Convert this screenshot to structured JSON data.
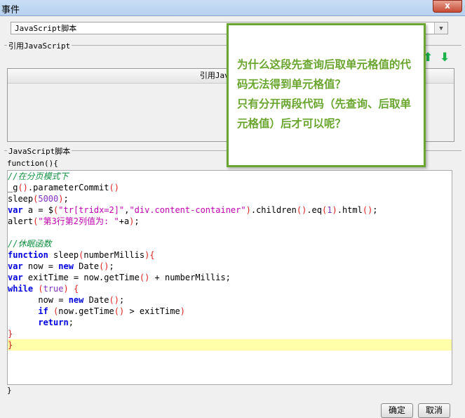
{
  "window": {
    "title": "事件",
    "close": "x"
  },
  "select": {
    "value": "JavaScript脚本"
  },
  "ref_section": {
    "legend": "引用JavaScript",
    "column_header": "引用JavaScript",
    "up": "⬆",
    "down": "⬇"
  },
  "script_section": {
    "legend": "JavaScript脚本",
    "head": "function(){",
    "tail": "}"
  },
  "code": [
    [
      [
        "cm",
        "//在分页模式下"
      ]
    ],
    [
      [
        "",
        "_g"
      ],
      [
        "p",
        "()"
      ],
      [
        "",
        ".parameterCommit"
      ],
      [
        "p",
        "()"
      ]
    ],
    [
      [
        "",
        "sleep"
      ],
      [
        "p",
        "("
      ],
      [
        "num",
        "5000"
      ],
      [
        "p",
        ")"
      ],
      [
        "",
        ";"
      ]
    ],
    [
      [
        "kw",
        "var"
      ],
      [
        "",
        " a = $"
      ],
      [
        "p",
        "("
      ],
      [
        "str",
        "\"tr[tridx=2]\""
      ],
      [
        "",
        ","
      ],
      [
        "str",
        "\"div.content-container\""
      ],
      [
        "p",
        ")"
      ],
      [
        "",
        ".children"
      ],
      [
        "p",
        "()"
      ],
      [
        "",
        ".eq"
      ],
      [
        "p",
        "("
      ],
      [
        "num",
        "1"
      ],
      [
        "p",
        ")"
      ],
      [
        "",
        ".html"
      ],
      [
        "p",
        "()"
      ],
      [
        "",
        ";"
      ]
    ],
    [
      [
        "",
        "alert"
      ],
      [
        "p",
        "("
      ],
      [
        "str",
        "\"第3行第2列值为: \""
      ],
      [
        "",
        "+a"
      ],
      [
        "p",
        ")"
      ],
      [
        "",
        ";"
      ]
    ],
    [],
    [
      [
        "cm",
        "//休眠函数"
      ]
    ],
    [
      [
        "kw",
        "function"
      ],
      [
        "",
        " sleep"
      ],
      [
        "p",
        "("
      ],
      [
        "",
        "numberMillis"
      ],
      [
        "p",
        ")"
      ],
      [
        "p",
        "{"
      ]
    ],
    [
      [
        "kw",
        "var"
      ],
      [
        "",
        " now = "
      ],
      [
        "kw",
        "new"
      ],
      [
        "",
        " Date"
      ],
      [
        "p",
        "()"
      ],
      [
        "",
        ";"
      ]
    ],
    [
      [
        "kw",
        "var"
      ],
      [
        "",
        " exitTime = now.getTime"
      ],
      [
        "p",
        "()"
      ],
      [
        "",
        " + numberMillis;"
      ]
    ],
    [
      [
        "kw",
        "while"
      ],
      [
        "",
        " "
      ],
      [
        "p",
        "("
      ],
      [
        "num",
        "true"
      ],
      [
        "p",
        ")"
      ],
      [
        "",
        " "
      ],
      [
        "p",
        "{"
      ]
    ],
    [
      [
        "",
        "      now = "
      ],
      [
        "kw",
        "new"
      ],
      [
        "",
        " Date"
      ],
      [
        "p",
        "()"
      ],
      [
        "",
        ";"
      ]
    ],
    [
      [
        "",
        "      "
      ],
      [
        "kw",
        "if"
      ],
      [
        "",
        " "
      ],
      [
        "p",
        "("
      ],
      [
        "",
        "now.getTime"
      ],
      [
        "p",
        "()"
      ],
      [
        "",
        " > exitTime"
      ],
      [
        "p",
        ")"
      ]
    ],
    [
      [
        "",
        "      "
      ],
      [
        "kw",
        "return"
      ],
      [
        "",
        ";"
      ]
    ],
    [
      [
        "p",
        "}"
      ]
    ],
    [
      [
        "p",
        "}"
      ]
    ]
  ],
  "buttons": {
    "ok": "确定",
    "cancel": "取消"
  },
  "callout": {
    "lines": [
      "为什么这段先查询后取单元格值的代码无法得到单元格值？",
      "只有分开两段代码（先查询、后取单元格值）后才可以呢？"
    ]
  }
}
